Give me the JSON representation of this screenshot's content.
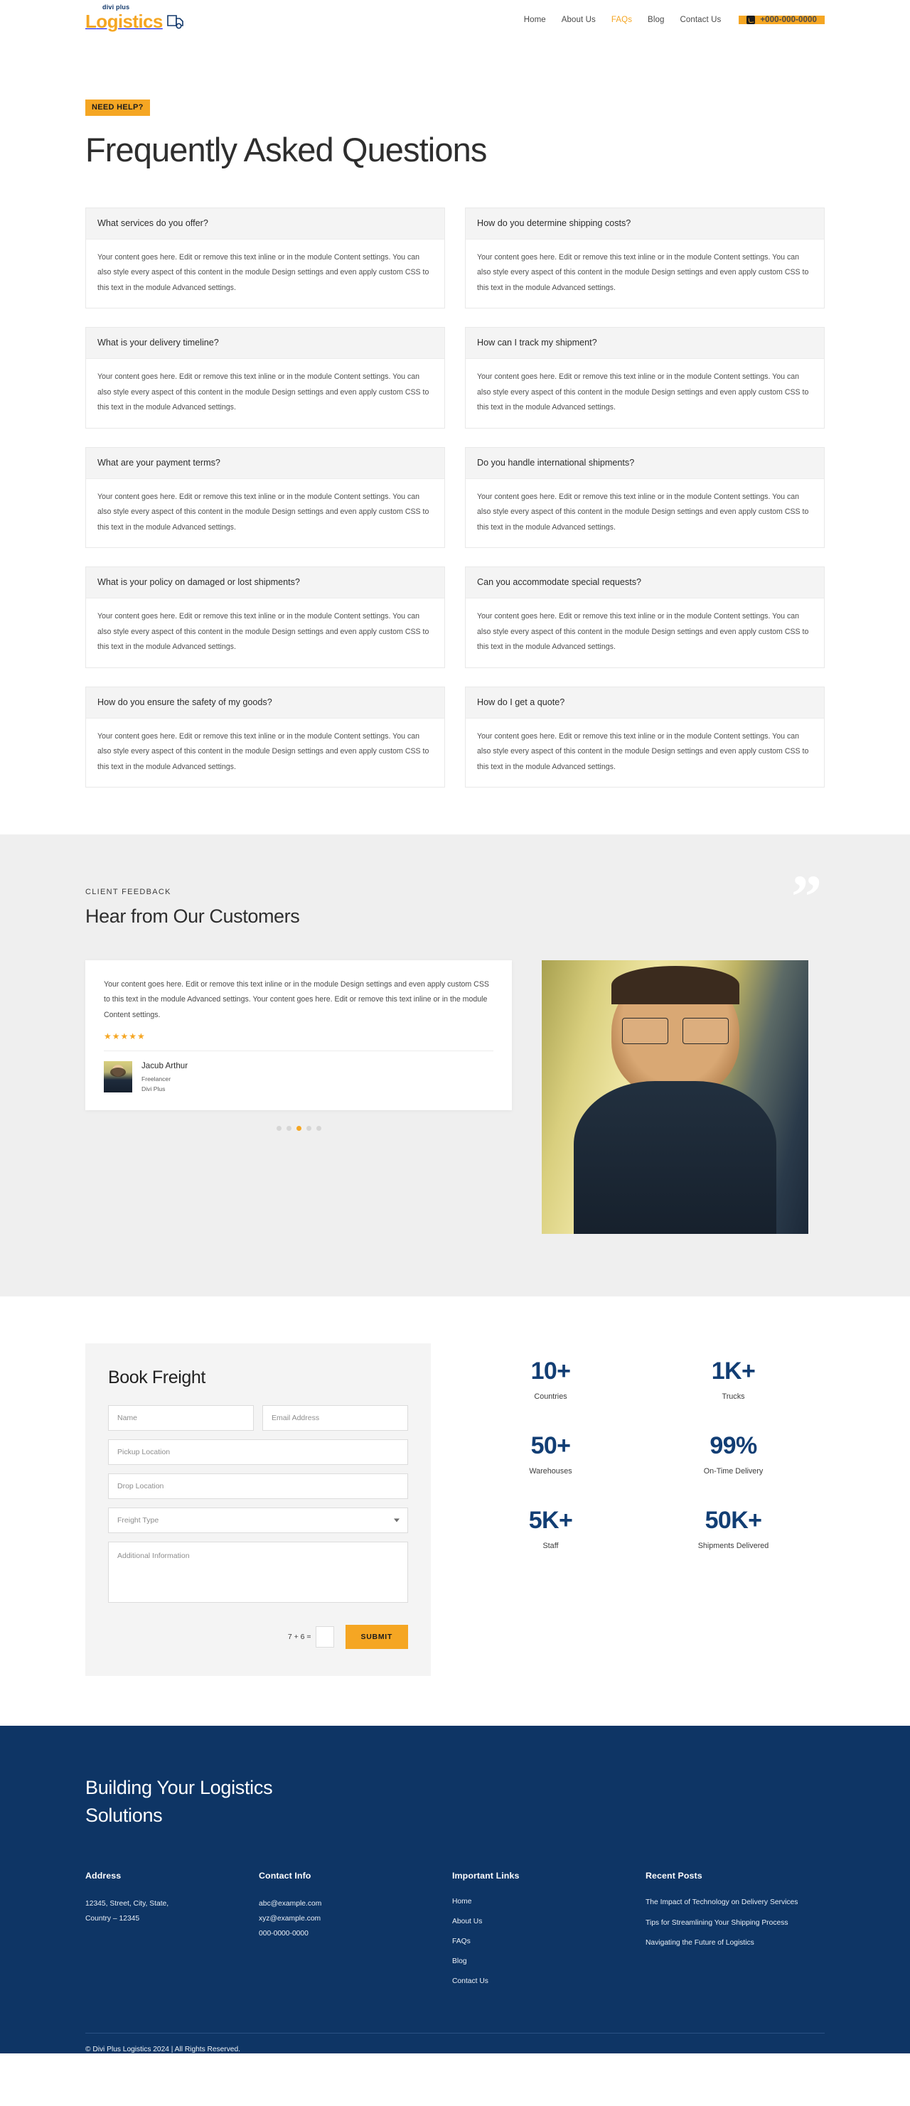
{
  "header": {
    "logo": {
      "top": "divi plus",
      "lead": "L",
      "main": "ogistics",
      "icon": "truck-icon"
    },
    "nav": [
      {
        "label": "Home",
        "active": false
      },
      {
        "label": "About Us",
        "active": false
      },
      {
        "label": "FAQs",
        "active": true
      },
      {
        "label": "Blog",
        "active": false
      },
      {
        "label": "Contact Us",
        "active": false
      }
    ],
    "phone_button": {
      "label": "+000-000-0000",
      "icon": "phone-icon",
      "bg": "#f5a623"
    }
  },
  "hero": {
    "badge": "NEED HELP?",
    "title": "Frequently Asked Questions"
  },
  "faq": {
    "answer": "Your content goes here. Edit or remove this text inline or in the module Content settings. You can also style every aspect of this content in the module Design settings and even apply custom CSS to this text in the module Advanced settings.",
    "items": [
      {
        "q": "What services do you offer?"
      },
      {
        "q": "How do you determine shipping costs?"
      },
      {
        "q": "What is your delivery timeline?"
      },
      {
        "q": "How can I track my shipment?"
      },
      {
        "q": "What are your payment terms?"
      },
      {
        "q": "Do you handle international shipments?"
      },
      {
        "q": "What is your policy on damaged or lost shipments?"
      },
      {
        "q": "Can you accommodate special requests?"
      },
      {
        "q": "How do you ensure the safety of my goods?"
      },
      {
        "q": "How do I get a quote?"
      }
    ]
  },
  "testimonials": {
    "eyebrow": "CLIENT FEEDBACK",
    "title": "Hear from Our Customers",
    "quote_glyph": "”",
    "card": {
      "text": "Your content goes here. Edit or remove this text inline or in the module Design settings and even apply custom CSS to this text in the module Advanced settings. Your content goes here. Edit or remove this text inline or in the module Content settings.",
      "stars": "★★★★★",
      "rating": 5,
      "name": "Jacub Arthur",
      "role": "Freelancer",
      "company": "Divi Plus"
    },
    "dots": {
      "count": 5,
      "active_index": 2
    }
  },
  "book": {
    "title": "Book Freight",
    "fields": {
      "name": "Name",
      "email": "Email Address",
      "pickup": "Pickup Location",
      "drop": "Drop Location",
      "freight_type": "Freight Type",
      "additional": "Additional Information"
    },
    "captcha_label": "7 + 6 =",
    "captcha_value": "",
    "submit_label": "SUBMIT"
  },
  "stats": {
    "accent": "#123e74",
    "items": [
      {
        "value": "10+",
        "label": "Countries"
      },
      {
        "value": "1K+",
        "label": "Trucks"
      },
      {
        "value": "50+",
        "label": "Warehouses"
      },
      {
        "value": "99%",
        "label": "On-Time Delivery"
      },
      {
        "value": "5K+",
        "label": "Staff"
      },
      {
        "value": "50K+",
        "label": "Shipments Delivered"
      }
    ]
  },
  "footer": {
    "bg": "#0e3565",
    "title": "Building Your Logistics Solutions",
    "address": {
      "heading": "Address",
      "line1": "12345, Street, City, State,",
      "line2": "Country – 12345"
    },
    "contact": {
      "heading": "Contact Info",
      "email1": "abc@example.com",
      "email2": "xyz@example.com",
      "phone": "000-0000-0000"
    },
    "links": {
      "heading": "Important Links",
      "items": [
        "Home",
        "About Us",
        "FAQs",
        "Blog",
        "Contact Us"
      ]
    },
    "posts": {
      "heading": "Recent Posts",
      "items": [
        "The Impact of Technology on Delivery Services",
        "Tips for Streamlining Your Shipping Process",
        "Navigating the Future of Logistics"
      ]
    },
    "copyright": "© Divi Plus Logistics 2024 | All Rights Reserved."
  }
}
